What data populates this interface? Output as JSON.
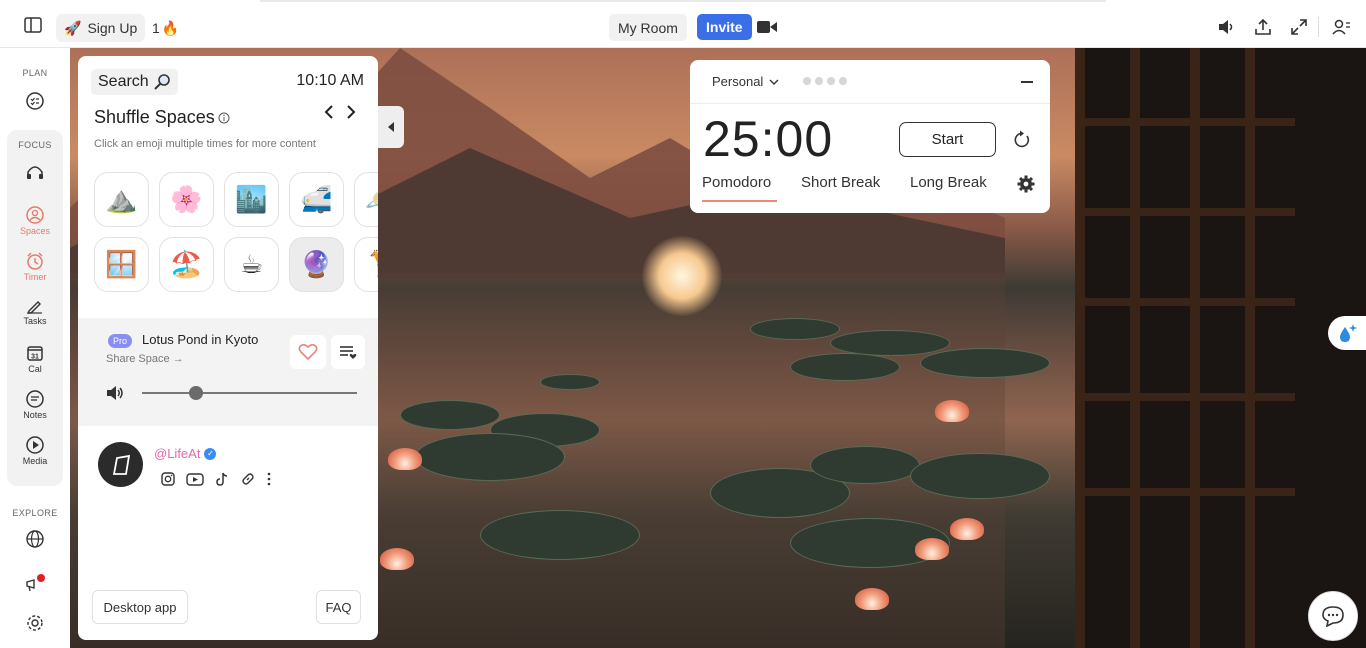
{
  "topbar": {
    "signup_label": "Sign Up",
    "streak_count": "1",
    "streak_emoji": "🔥",
    "rocket_emoji": "🚀",
    "myroom_label": "My Room",
    "invite_label": "Invite"
  },
  "rail": {
    "plan_label": "PLAN",
    "focus_label": "FOCUS",
    "explore_label": "EXPLORE",
    "items": [
      {
        "label": "Spaces",
        "icon": "spaces-icon"
      },
      {
        "label": "Timer",
        "icon": "timer-icon"
      },
      {
        "label": "Tasks",
        "icon": "tasks-icon"
      },
      {
        "label": "Cal",
        "icon": "calendar-icon"
      },
      {
        "label": "Notes",
        "icon": "notes-icon"
      },
      {
        "label": "Media",
        "icon": "media-icon"
      }
    ],
    "active_color": "#e47a6a"
  },
  "panel": {
    "search_label": "Search",
    "clock": "10:10 AM",
    "shuffle_title": "Shuffle Spaces",
    "hint": "Click an emoji multiple times for more content",
    "emojis": [
      "⛰️",
      "🌸",
      "🏙️",
      "🚅",
      "🪐",
      "🪟",
      "🏖️",
      "☕",
      "🔮",
      "🦒"
    ],
    "track": {
      "badge": "Pro",
      "title": "Lotus Pond in Kyoto",
      "share": "Share Space →",
      "volume": 0.25
    },
    "creator": {
      "handle": "@LifeAt"
    },
    "desktop_label": "Desktop app",
    "faq_label": "FAQ"
  },
  "timer": {
    "mode_select": "Personal",
    "time": "25:00",
    "start_label": "Start",
    "modes": [
      "Pomodoro",
      "Short Break",
      "Long Break"
    ],
    "active_mode": "Pomodoro",
    "accent": "#e98a7c"
  },
  "colors": {
    "invite_bg": "#3b6fe8",
    "creator_handle": "#e06aa8",
    "pro_badge": "#8a8ef0"
  }
}
